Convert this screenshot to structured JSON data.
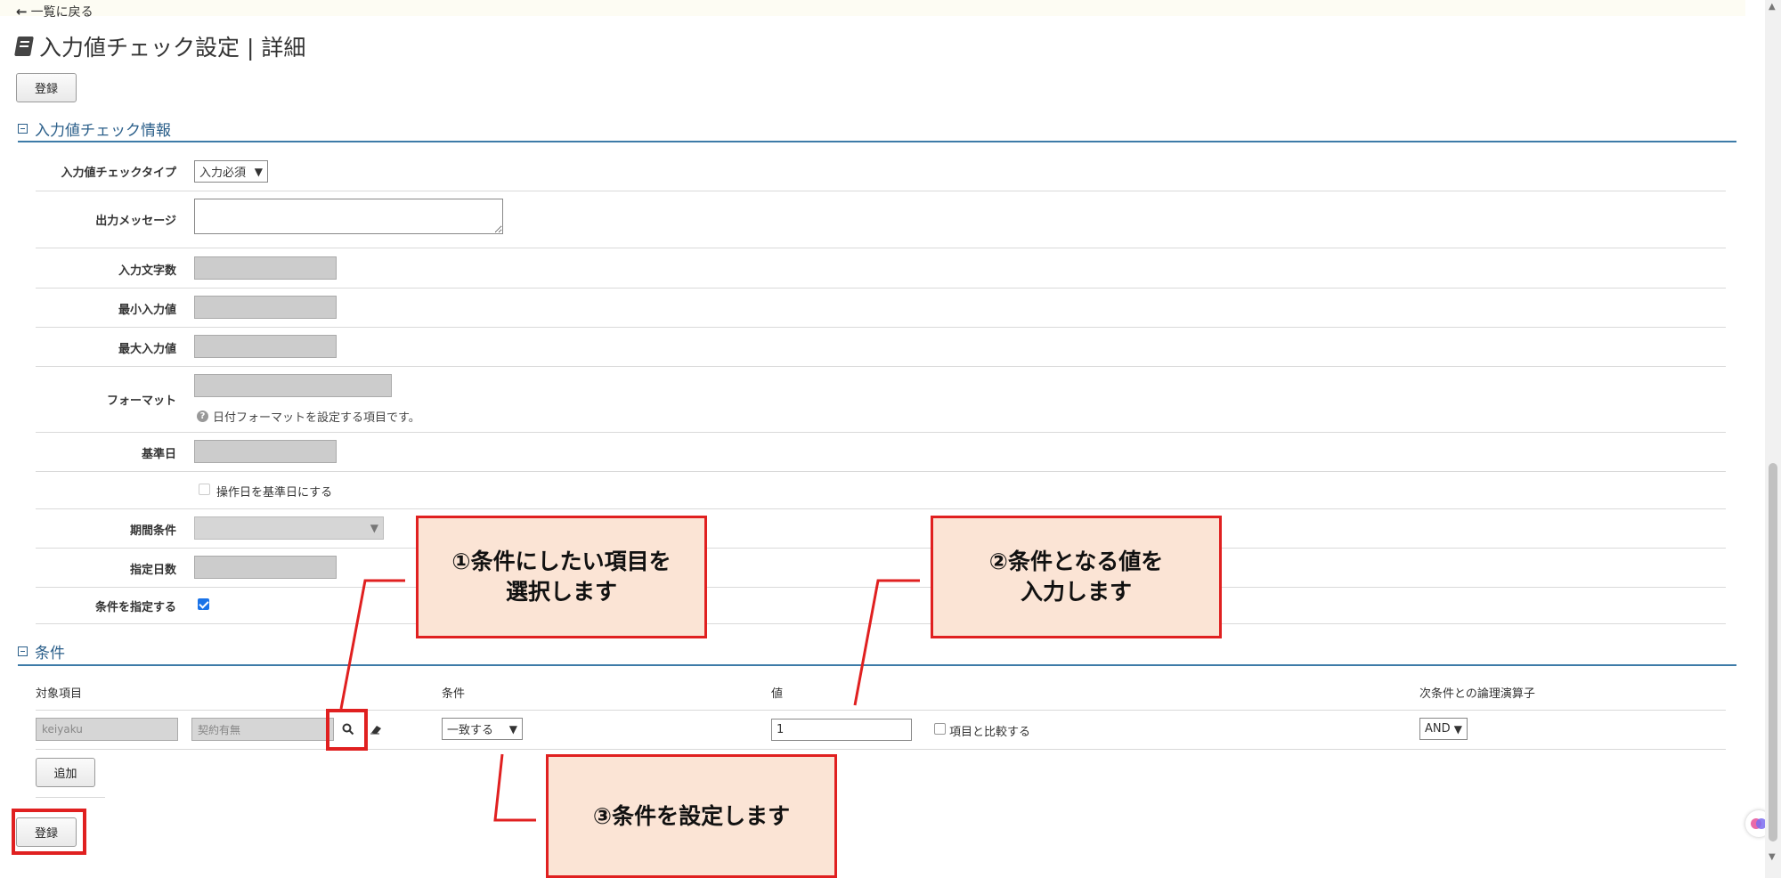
{
  "nav": {
    "back_label": "一覧に戻る"
  },
  "page": {
    "title": "入力値チェック設定 | 詳細"
  },
  "buttons": {
    "register_top": "登録",
    "register_bottom": "登録",
    "add": "追加"
  },
  "section_info": {
    "header": "入力値チェック情報",
    "fields": {
      "check_type_label": "入力値チェックタイプ",
      "check_type_value": "入力必須",
      "message_label": "出力メッセージ",
      "char_count_label": "入力文字数",
      "min_label": "最小入力値",
      "max_label": "最大入力値",
      "format_label": "フォーマット",
      "format_hint": "日付フォーマットを設定する項目です。",
      "base_date_label": "基準日",
      "use_operation_date_label": "操作日を基準日にする",
      "period_label": "期間条件",
      "days_label": "指定日数",
      "specify_condition_label": "条件を指定する",
      "specify_condition_checked": true
    }
  },
  "section_condition": {
    "header": "条件",
    "columns": [
      "対象項目",
      "条件",
      "値",
      "次条件との論理演算子"
    ],
    "row": {
      "item_code": "keiyaku",
      "item_name": "契約有無",
      "condition": "一致する",
      "value": "1",
      "compare_label": "項目と比較する",
      "operator": "AND"
    }
  },
  "callouts": {
    "c1_line1": "①条件にしたい項目を",
    "c1_line2": "選択します",
    "c2_line1": "②条件となる値を",
    "c2_line2": "入力します",
    "c3": "③条件を設定します"
  },
  "colors": {
    "accent_line": "#3d7ba8",
    "callout_bg": "#fbe4d5",
    "callout_border": "#e02020"
  }
}
